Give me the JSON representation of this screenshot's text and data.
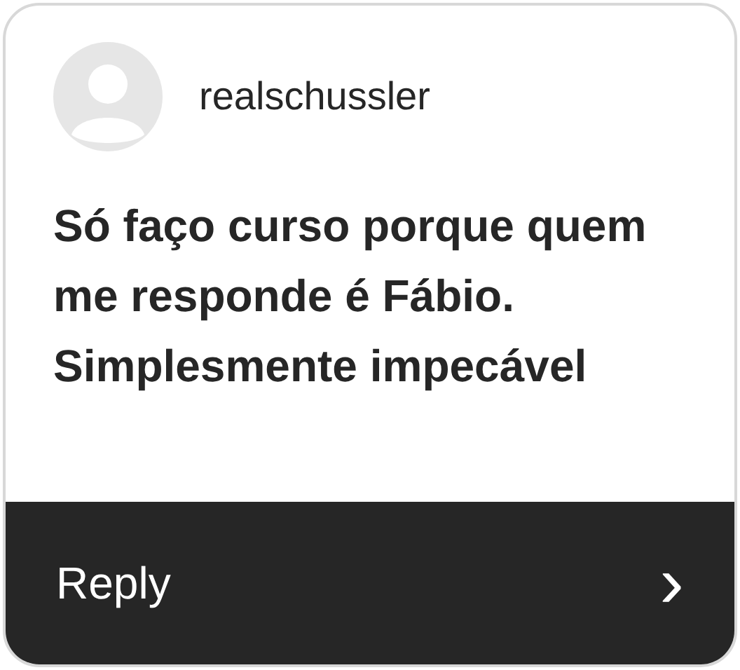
{
  "comment": {
    "username": "realschussler",
    "text": "Só faço curso porque quem me responde é Fábio.  Simplesmente impecável"
  },
  "footer": {
    "label": "Reply",
    "chevron": "›"
  }
}
